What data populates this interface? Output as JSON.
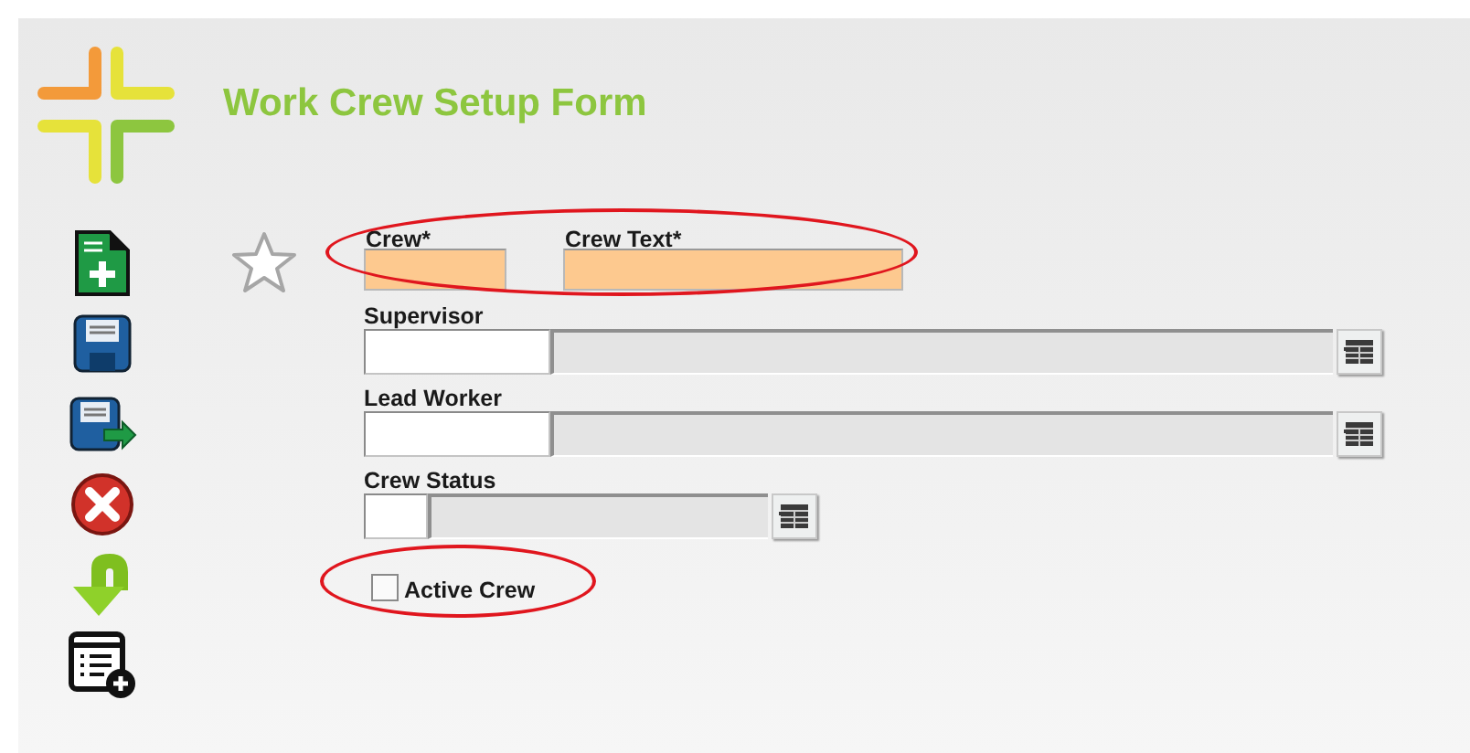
{
  "title": "Work Crew Setup Form",
  "toolbar": [
    {
      "kind": "new"
    },
    {
      "kind": "save"
    },
    {
      "kind": "save_as"
    },
    {
      "kind": "cancel"
    },
    {
      "kind": "download"
    },
    {
      "kind": "list_add"
    }
  ],
  "favorite": {
    "selected": false
  },
  "crew_row": {
    "highlighted": true,
    "fields": [
      {
        "label": "Crew*",
        "required": true
      },
      {
        "label": "Crew Text*",
        "required": true
      }
    ]
  },
  "lookups": [
    {
      "label": "Supervisor",
      "kind": "wide"
    },
    {
      "label": "Lead Worker",
      "kind": "wide"
    },
    {
      "label": "Crew Status",
      "kind": "short"
    }
  ],
  "active_crew": {
    "label": "Active Crew",
    "checked": false,
    "highlighted": true
  }
}
